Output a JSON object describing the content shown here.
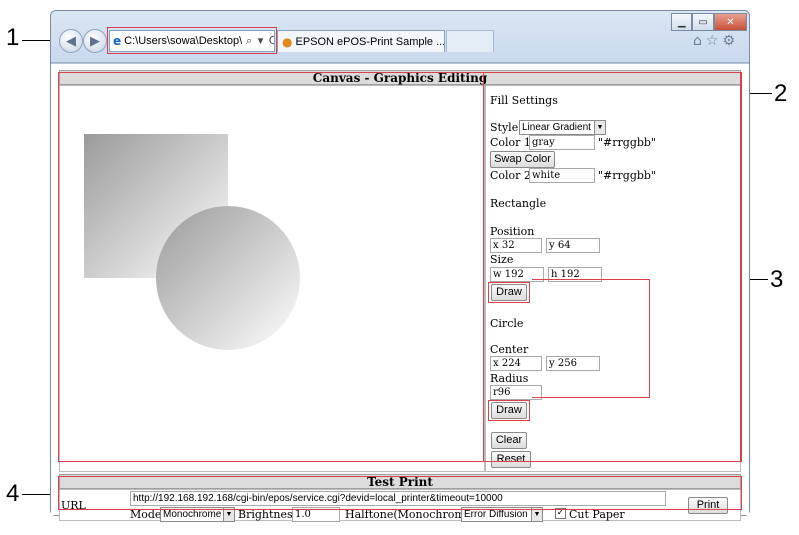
{
  "callouts": [
    "1",
    "2",
    "3",
    "4"
  ],
  "browser": {
    "address": "C:\\Users\\sowa\\Desktop\\",
    "address_tools": "⌕ ▾ C ✕",
    "tab_title": "EPSON ePOS-Print Sample ...",
    "tab_close": "×",
    "win_controls": [
      "▁",
      "▭",
      "✕"
    ],
    "toolbar_icons": [
      "home-icon",
      "star-icon",
      "gear-icon"
    ]
  },
  "canvas_section": {
    "title": "Canvas - Graphics Editing"
  },
  "fill_settings": {
    "heading": "Fill Settings",
    "style_label": "Style",
    "style_value": "Linear Gradient",
    "color1_label": "Color 1",
    "color1_value": "gray",
    "color_hint": "\"#rrggbb\"",
    "swap_label": "Swap Color",
    "color2_label": "Color 2",
    "color2_value": "white"
  },
  "rectangle": {
    "heading": "Rectangle",
    "position_label": "Position",
    "x_label": "x",
    "x_value": "32",
    "y_label": "y",
    "y_value": "64",
    "size_label": "Size",
    "w_label": "w",
    "w_value": "192",
    "h_label": "h",
    "h_value": "192",
    "draw_label": "Draw"
  },
  "circle": {
    "heading": "Circle",
    "center_label": "Center",
    "x_label": "x",
    "x_value": "224",
    "y_label": "y",
    "y_value": "256",
    "radius_label": "Radius",
    "r_label": "r",
    "r_value": "96",
    "draw_label": "Draw"
  },
  "actions": {
    "clear_label": "Clear",
    "reset_label": "Reset"
  },
  "test_print": {
    "title": "Test Print",
    "url_label": "URL",
    "url_value": "http://192.168.192.168/cgi-bin/epos/service.cgi?devid=local_printer&timeout=10000",
    "mode_label": "Mode",
    "mode_value": "Monochrome",
    "brightness_label": "Brightness",
    "brightness_value": "1.0",
    "halftone_label": "Halftone(Monochrome)",
    "halftone_value": "Error Diffusion",
    "cut_paper_label": "Cut Paper",
    "cut_paper_checked": true,
    "print_label": "Print"
  },
  "colors": {
    "callout_red": "#d9414a",
    "gradient_start": "#9a9a9a",
    "gradient_end": "#ffffff"
  }
}
